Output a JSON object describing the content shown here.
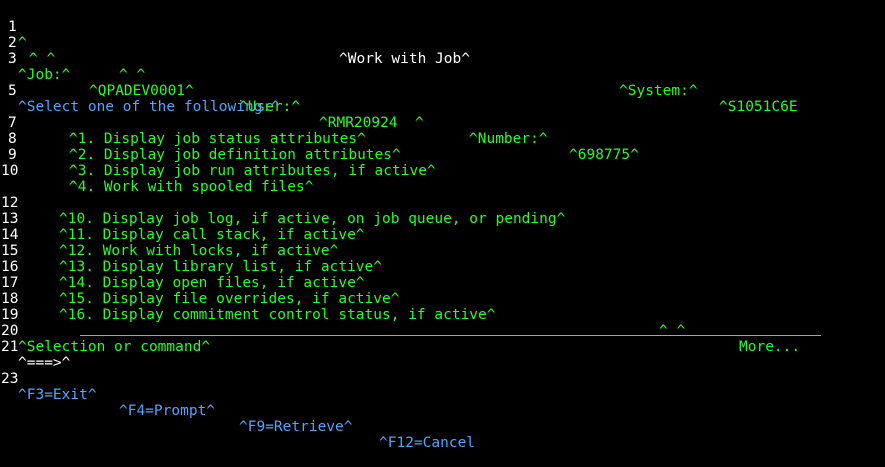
{
  "rownums": {
    "r1": "1",
    "r2": "2",
    "r3": "3",
    "r5": "5",
    "r7": "7",
    "r8": "8",
    "r9": "9",
    "r10": "10",
    "r12": "12",
    "r13": "13",
    "r14": "14",
    "r15": "15",
    "r16": "16",
    "r17": "17",
    "r18": "18",
    "r19": "19",
    "r20": "20",
    "r21": "21",
    "r23": "23"
  },
  "header": {
    "r1_marker": "^",
    "title": "^Work with Job^",
    "r2_markers_a": "^ ^",
    "r2_markers_b": "^ ^",
    "system_label": "^System:^",
    "system_value": "^S1051C6E",
    "job_label": "^Job:^",
    "job_value": "^QPADEV0001^",
    "user_label": "^User:^",
    "user_value": "^RMR20924  ^",
    "number_label": "^Number:^",
    "number_value": "^698775^"
  },
  "instruction": "^Select one of the following:^",
  "options": {
    "o1": "^1. Display job status attributes^",
    "o2": "^2. Display job definition attributes^",
    "o3": "^3. Display job run attributes, if active^",
    "o4": "^4. Work with spooled files^",
    "o10": "^10. Display job log, if active, on job queue, or pending^",
    "o11": "^11. Display call stack, if active^",
    "o12": "^12. Work with locks, if active^",
    "o13": "^13. Display library list, if active^",
    "o14": "^14. Display open files, if active^",
    "o15": "^15. Display file overrides, if active^",
    "o16": "^16. Display commitment control status, if active^"
  },
  "more": {
    "markers": "^ ^",
    "label": "More..."
  },
  "selection_label": "^Selection or command^",
  "prompt_arrow": "^===>^",
  "command_value": "",
  "fkeys": {
    "f3": "^F3=Exit^",
    "f4": "^F4=Prompt^",
    "f9": "^F9=Retrieve^",
    "f12": "^F12=Cancel"
  },
  "colors": {
    "background": "#000000",
    "green": "#22ff22",
    "blue": "#4da6ff",
    "white": "#ffffff"
  }
}
